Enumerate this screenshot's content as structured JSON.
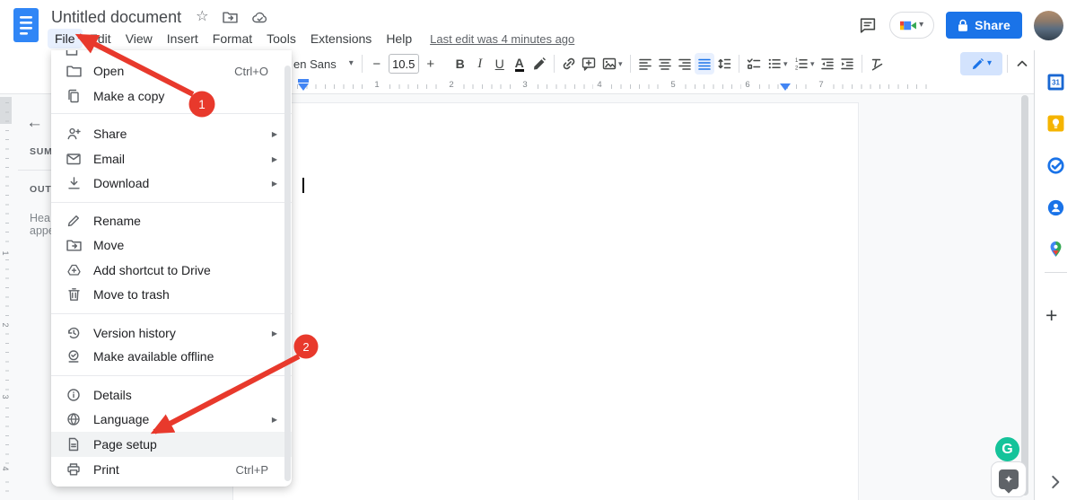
{
  "header": {
    "title": "Untitled document",
    "menu_bar": [
      "File",
      "Edit",
      "View",
      "Insert",
      "Format",
      "Tools",
      "Extensions",
      "Help"
    ],
    "last_edit": "Last edit was 4 minutes ago",
    "share_label": "Share"
  },
  "toolbar": {
    "font_name": "en Sans",
    "font_size": "10.5",
    "minus": "−",
    "plus": "+",
    "bold": "B",
    "italic": "I",
    "underline": "U",
    "text_color": "A",
    "caret_down": "▾"
  },
  "file_menu": {
    "items": [
      {
        "label": "Open",
        "shortcut": "Ctrl+O"
      },
      {
        "label": "Make a copy"
      },
      {
        "label": "Share",
        "submenu": "▶"
      },
      {
        "label": "Email",
        "submenu": "▶"
      },
      {
        "label": "Download",
        "submenu": "▶"
      },
      {
        "label": "Rename"
      },
      {
        "label": "Move"
      },
      {
        "label": "Add shortcut to Drive"
      },
      {
        "label": "Move to trash"
      },
      {
        "label": "Version history",
        "submenu": "▶"
      },
      {
        "label": "Make available offline"
      },
      {
        "label": "Details"
      },
      {
        "label": "Language",
        "submenu": "▶"
      },
      {
        "label": "Page setup"
      },
      {
        "label": "Print",
        "shortcut": "Ctrl+P"
      }
    ]
  },
  "outline_panel": {
    "back_arrow": "←",
    "summary": "SUM",
    "outline": "OUTL",
    "hint_line1": "Hea",
    "hint_line2": "appe"
  },
  "ruler": {
    "h": [
      "1",
      "2",
      "3",
      "4",
      "5",
      "6",
      "7"
    ],
    "v": [
      "1",
      "2",
      "3",
      "4"
    ]
  },
  "title_icons": {
    "star": "☆"
  },
  "sidebar": {
    "calendar_text": "31",
    "add": "+"
  },
  "widgets": {
    "grammarly_text": "G",
    "explore_star": "✦"
  },
  "annotations": {
    "step1": "1",
    "step2": "2",
    "color": "#e8392c"
  },
  "colors": {
    "accent_blue": "#1a73e8",
    "active_menu_chip": "#e8f0fe",
    "hover_row": "#f1f3f4",
    "doc_background": "#f8f9fa",
    "annotation_red": "#e8392c",
    "share_button": "#1a73e8"
  }
}
